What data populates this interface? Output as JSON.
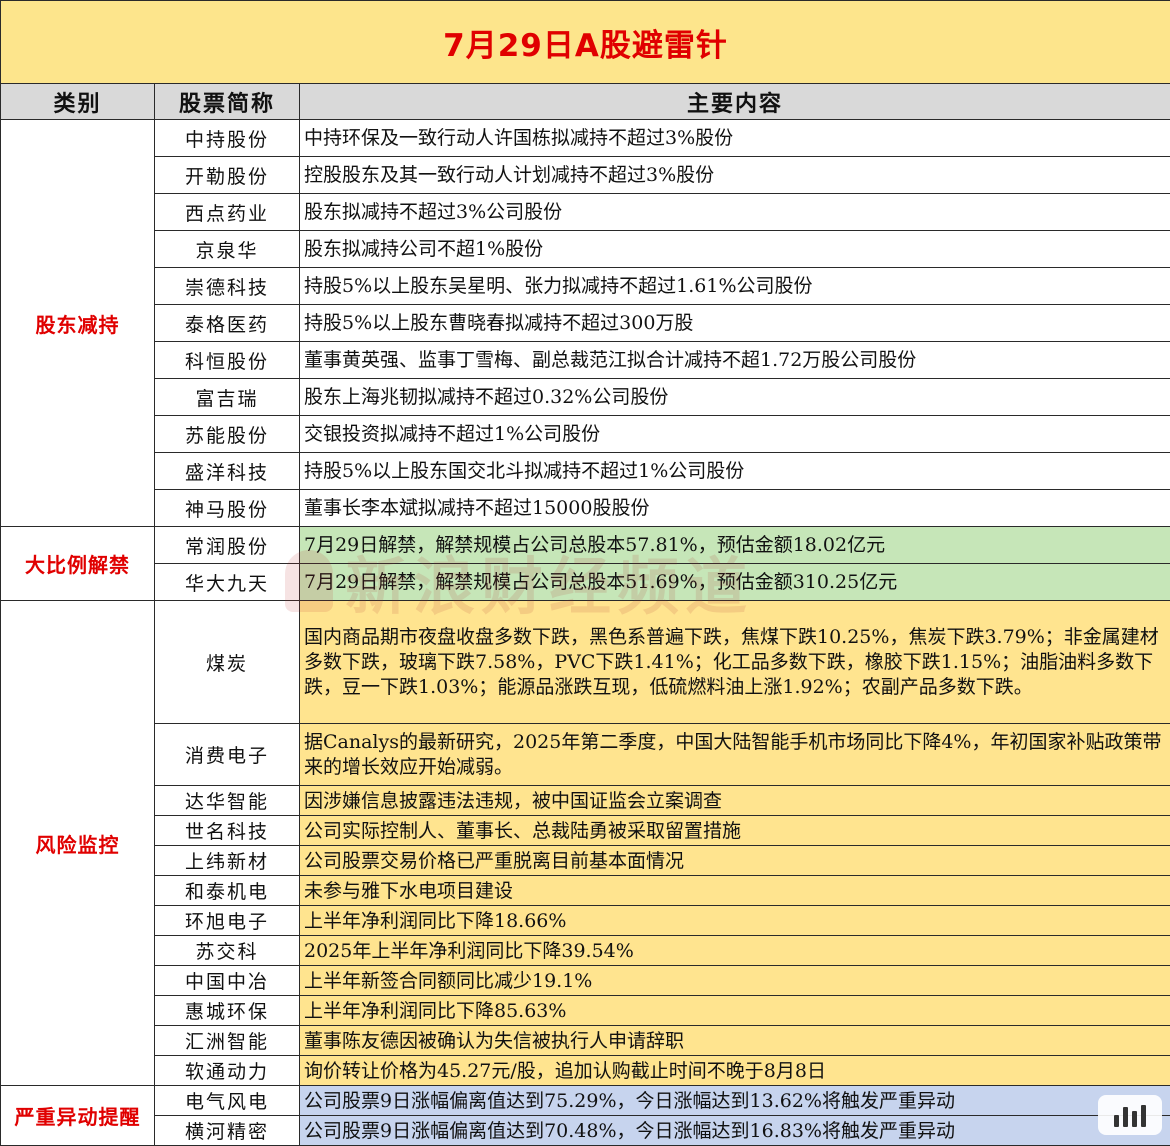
{
  "title": "7月29日A股避雷针",
  "headers": {
    "category": "类别",
    "stock": "股票简称",
    "content": "主要内容"
  },
  "groups": {
    "reduction": {
      "label": "股东减持",
      "rows": [
        {
          "name": "中持股份",
          "content": "中持环保及一致行动人许国栋拟减持不超过3%股份"
        },
        {
          "name": "开勒股份",
          "content": "控股股东及其一致行动人计划减持不超过3%股份"
        },
        {
          "name": "西点药业",
          "content": "股东拟减持不超过3%公司股份"
        },
        {
          "name": "京泉华",
          "content": "股东拟减持公司不超1%股份"
        },
        {
          "name": "崇德科技",
          "content": "持股5%以上股东吴星明、张力拟减持不超过1.61%公司股份"
        },
        {
          "name": "泰格医药",
          "content": "持股5%以上股东曹晓春拟减持不超过300万股"
        },
        {
          "name": "科恒股份",
          "content": "董事黄英强、监事丁雪梅、副总裁范江拟合计减持不超1.72万股公司股份"
        },
        {
          "name": "富吉瑞",
          "content": "股东上海兆韧拟减持不超过0.32%公司股份"
        },
        {
          "name": "苏能股份",
          "content": "交银投资拟减持不超过1%公司股份"
        },
        {
          "name": "盛洋科技",
          "content": "持股5%以上股东国交北斗拟减持不超过1%公司股份"
        },
        {
          "name": "神马股份",
          "content": "董事长李本斌拟减持不超过15000股股份"
        }
      ]
    },
    "unlock": {
      "label": "大比例解禁",
      "rows": [
        {
          "name": "常润股份",
          "content": "7月29日解禁，解禁规模占公司总股本57.81%，预估金额18.02亿元"
        },
        {
          "name": "华大九天",
          "content": "7月29日解禁，解禁规模占公司总股本51.69%，预估金额310.25亿元"
        }
      ]
    },
    "risk": {
      "label": "风险监控",
      "rows": [
        {
          "name": "煤炭",
          "content": "国内商品期市夜盘收盘多数下跌，黑色系普遍下跌，焦煤下跌10.25%，焦炭下跌3.79%；非金属建材多数下跌，玻璃下跌7.58%，PVC下跌1.41%；化工品多数下跌，橡胶下跌1.15%；油脂油料多数下跌，豆一下跌1.03%；能源品涨跌互现，低硫燃料油上涨1.92%；农副产品多数下跌。"
        },
        {
          "name": "消费电子",
          "content": "据Canalys的最新研究，2025年第二季度，中国大陆智能手机市场同比下降4%，年初国家补贴政策带来的增长效应开始减弱。"
        },
        {
          "name": "达华智能",
          "content": "因涉嫌信息披露违法违规，被中国证监会立案调查"
        },
        {
          "name": "世名科技",
          "content": "公司实际控制人、董事长、总裁陆勇被采取留置措施"
        },
        {
          "name": "上纬新材",
          "content": "公司股票交易价格已严重脱离目前基本面情况"
        },
        {
          "name": "和泰机电",
          "content": "未参与雅下水电项目建设"
        },
        {
          "name": "环旭电子",
          "content": "上半年净利润同比下降18.66%"
        },
        {
          "name": "苏交科",
          "content": "2025年上半年净利润同比下降39.54%"
        },
        {
          "name": "中国中冶",
          "content": "上半年新签合同额同比减少19.1%"
        },
        {
          "name": "惠城环保",
          "content": "上半年净利润同比下降85.63%"
        },
        {
          "name": "汇洲智能",
          "content": "董事陈友德因被确认为失信被执行人申请辞职"
        },
        {
          "name": "软通动力",
          "content": "询价转让价格为45.27元/股，追加认购截止时间不晚于8月8日"
        }
      ]
    },
    "abnormal": {
      "label": "严重异动提醒",
      "rows": [
        {
          "name": "电气风电",
          "content": "公司股票9日涨幅偏离值达到75.29%，今日涨幅达到13.62%将触发严重异动"
        },
        {
          "name": "横河精密",
          "content": "公司股票9日涨幅偏离值达到70.48%，今日涨幅达到16.83%将触发严重异动"
        }
      ]
    }
  },
  "colors": {
    "title_bg": "#fde58c",
    "accent_red": "#e00000",
    "unlock_bg": "#c6e6b8",
    "risk_bg": "#ffe48f",
    "abnormal_bg": "#c7d4ee"
  }
}
